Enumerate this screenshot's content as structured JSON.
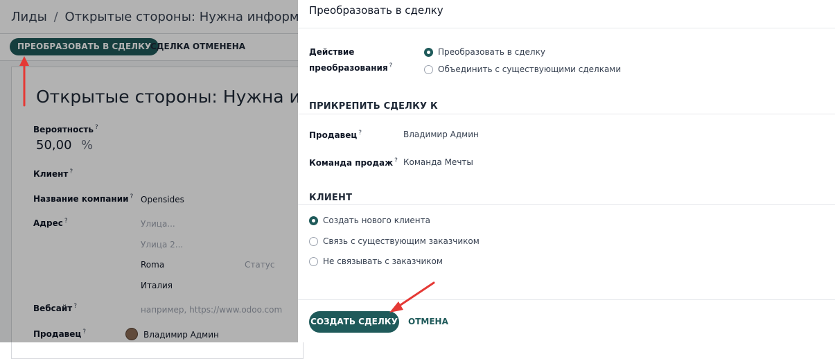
{
  "background": {
    "breadcrumb": {
      "parent": "Лиды",
      "separator": "/",
      "current": "Открытые стороны: Нужна информация"
    },
    "toolbar": {
      "convert_label": "ПРЕОБРАЗОВАТЬ В СДЕЛКУ",
      "lost_label": "СДЕЛКА ОТМЕНЕНА"
    },
    "record_title": "Открытые стороны: Нужна инфо",
    "fields": {
      "probability_label": "Вероятность",
      "probability_value": "50,00",
      "probability_unit": "%",
      "client_label": "Клиент",
      "company_label": "Название компании",
      "company_value": "Opensides",
      "address_label": "Адрес",
      "street_placeholder": "Улица...",
      "street2_placeholder": "Улица 2...",
      "city_value": "Roma",
      "state_placeholder": "Статус",
      "country_value": "Италия",
      "website_label": "Вебсайт",
      "website_placeholder": "например, https://www.odoo.com",
      "salesperson_label": "Продавец",
      "salesperson_value": "Владимир Админ"
    },
    "help_mark": "?"
  },
  "dialog": {
    "title": "Преобразовать в сделку",
    "action": {
      "label_line1": "Действие",
      "label_line2": "преобразования",
      "options": [
        {
          "label": "Преобразовать в сделку",
          "selected": true
        },
        {
          "label": "Объединить с существующими сделками",
          "selected": false
        }
      ]
    },
    "assign": {
      "heading": "ПРИКРЕПИТЬ СДЕЛКУ К",
      "salesperson_label": "Продавец",
      "salesperson_value": "Владимир Админ",
      "team_label": "Команда продаж",
      "team_value": "Команда Мечты"
    },
    "customer": {
      "heading": "КЛИЕНТ",
      "options": [
        {
          "label": "Создать нового клиента",
          "selected": true
        },
        {
          "label": "Связь с существующим заказчиком",
          "selected": false
        },
        {
          "label": "Не связывать с заказчиком",
          "selected": false
        }
      ]
    },
    "footer": {
      "create_label": "СОЗДАТЬ СДЕЛКУ",
      "cancel_label": "ОТМЕНА"
    }
  },
  "colors": {
    "primary": "#1f5a5a",
    "annotation_arrow": "#e53935"
  },
  "icons": [
    "help-mark-icon",
    "radio-icon",
    "avatar",
    "annotation-arrow-icon"
  ]
}
